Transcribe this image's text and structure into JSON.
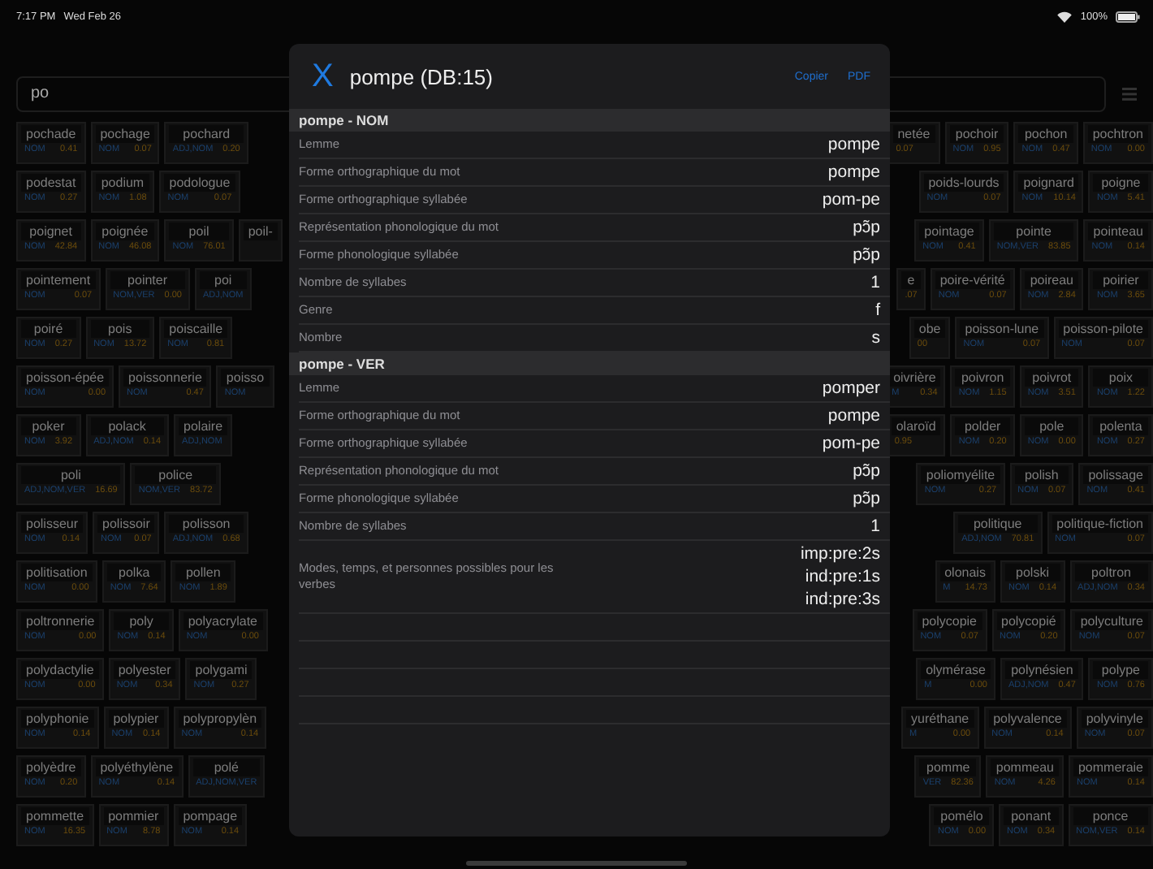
{
  "status_bar": {
    "time": "7:17 PM",
    "date": "Wed Feb 26",
    "battery": "100%"
  },
  "search": {
    "value": "po"
  },
  "tile_rows": [
    {
      "left": [
        {
          "word": "pochade",
          "category": "NOM",
          "frequency": "0.41"
        },
        {
          "word": "pochage",
          "category": "NOM",
          "frequency": "0.07"
        },
        {
          "word": "pochard",
          "category": "ADJ,NOM",
          "frequency": "0.20"
        }
      ],
      "right": [
        {
          "word": "netée",
          "frequency": "0.07"
        },
        {
          "word": "pochoir",
          "category": "NOM",
          "frequency": "0.95"
        },
        {
          "word": "pochon",
          "category": "NOM",
          "frequency": "0.47"
        },
        {
          "word": "pochtron",
          "category": "NOM",
          "frequency": "0.00"
        }
      ]
    },
    {
      "left": [
        {
          "word": "podestat",
          "category": "NOM",
          "frequency": "0.27"
        },
        {
          "word": "podium",
          "category": "NOM",
          "frequency": "1.08"
        },
        {
          "word": "podologue",
          "category": "NOM",
          "frequency": "0.07"
        }
      ],
      "right": [
        {
          "word": "poids-lourds",
          "category": "NOM",
          "frequency": "0.07"
        },
        {
          "word": "poignard",
          "category": "NOM",
          "frequency": "10.14"
        },
        {
          "word": "poigne",
          "category": "NOM",
          "frequency": "5.41"
        }
      ]
    },
    {
      "left": [
        {
          "word": "poignet",
          "category": "NOM",
          "frequency": "42.84"
        },
        {
          "word": "poignée",
          "category": "NOM",
          "frequency": "46.08"
        },
        {
          "word": "poil",
          "category": "NOM",
          "frequency": "76.01"
        },
        {
          "word": "poil-"
        }
      ],
      "right": [
        {
          "word": "pointage",
          "category": "NOM",
          "frequency": "0.41"
        },
        {
          "word": "pointe",
          "category": "NOM,VER",
          "frequency": "83.85"
        },
        {
          "word": "pointeau",
          "category": "NOM",
          "frequency": "0.14"
        }
      ]
    },
    {
      "left": [
        {
          "word": "pointement",
          "category": "NOM",
          "frequency": "0.07"
        },
        {
          "word": "pointer",
          "category": "NOM,VER",
          "frequency": "0.00"
        },
        {
          "word": "poi",
          "category": "ADJ,NOM"
        }
      ],
      "right": [
        {
          "word": "e",
          "frequency": ".07"
        },
        {
          "word": "poire-vérité",
          "category": "NOM",
          "frequency": "0.07"
        },
        {
          "word": "poireau",
          "category": "NOM",
          "frequency": "2.84"
        },
        {
          "word": "poirier",
          "category": "NOM",
          "frequency": "3.65"
        }
      ]
    },
    {
      "left": [
        {
          "word": "poiré",
          "category": "NOM",
          "frequency": "0.27"
        },
        {
          "word": "pois",
          "category": "NOM",
          "frequency": "13.72"
        },
        {
          "word": "poiscaille",
          "category": "NOM",
          "frequency": "0.81"
        }
      ],
      "right": [
        {
          "word": "obe",
          "frequency": "00"
        },
        {
          "word": "poisson-lune",
          "category": "NOM",
          "frequency": "0.07"
        },
        {
          "word": "poisson-pilote",
          "category": "NOM",
          "frequency": "0.07"
        }
      ]
    },
    {
      "left": [
        {
          "word": "poisson-épée",
          "category": "NOM",
          "frequency": "0.00"
        },
        {
          "word": "poissonnerie",
          "category": "NOM",
          "frequency": "0.47"
        },
        {
          "word": "poisso",
          "category": "NOM"
        }
      ],
      "right": [
        {
          "word": "oivrière",
          "category": "M",
          "frequency": "0.34"
        },
        {
          "word": "poivron",
          "category": "NOM",
          "frequency": "1.15"
        },
        {
          "word": "poivrot",
          "category": "NOM",
          "frequency": "3.51"
        },
        {
          "word": "poix",
          "category": "NOM",
          "frequency": "1.22"
        }
      ]
    },
    {
      "left": [
        {
          "word": "poker",
          "category": "NOM",
          "frequency": "3.92"
        },
        {
          "word": "polack",
          "category": "ADJ,NOM",
          "frequency": "0.14"
        },
        {
          "word": "polaire",
          "category": "ADJ,NOM"
        }
      ],
      "right": [
        {
          "word": "olaroïd",
          "frequency": "0.95"
        },
        {
          "word": "polder",
          "category": "NOM",
          "frequency": "0.20"
        },
        {
          "word": "pole",
          "category": "NOM",
          "frequency": "0.00"
        },
        {
          "word": "polenta",
          "category": "NOM",
          "frequency": "0.27"
        }
      ]
    },
    {
      "left": [
        {
          "word": "poli",
          "category": "ADJ,NOM,VER",
          "frequency": "16.69"
        },
        {
          "word": "police",
          "category": "NOM,VER",
          "frequency": "83.72"
        }
      ],
      "right": [
        {
          "word": "poliomyélite",
          "category": "NOM",
          "frequency": "0.27"
        },
        {
          "word": "polish",
          "category": "NOM",
          "frequency": "0.07"
        },
        {
          "word": "polissage",
          "category": "NOM",
          "frequency": "0.41"
        }
      ]
    },
    {
      "left": [
        {
          "word": "polisseur",
          "category": "NOM",
          "frequency": "0.14"
        },
        {
          "word": "polissoir",
          "category": "NOM",
          "frequency": "0.07"
        },
        {
          "word": "polisson",
          "category": "ADJ,NOM",
          "frequency": "0.68"
        }
      ],
      "right": [
        {
          "word": "politique",
          "category": "ADJ,NOM",
          "frequency": "70.81"
        },
        {
          "word": "politique-fiction",
          "category": "NOM",
          "frequency": "0.07"
        }
      ]
    },
    {
      "left": [
        {
          "word": "politisation",
          "category": "NOM",
          "frequency": "0.00"
        },
        {
          "word": "polka",
          "category": "NOM",
          "frequency": "7.64"
        },
        {
          "word": "pollen",
          "category": "NOM",
          "frequency": "1.89"
        }
      ],
      "right": [
        {
          "word": "olonais",
          "category": "M",
          "frequency": "14.73"
        },
        {
          "word": "polski",
          "category": "NOM",
          "frequency": "0.14"
        },
        {
          "word": "poltron",
          "category": "ADJ,NOM",
          "frequency": "0.34"
        }
      ]
    },
    {
      "left": [
        {
          "word": "poltronnerie",
          "category": "NOM",
          "frequency": "0.00"
        },
        {
          "word": "poly",
          "category": "NOM",
          "frequency": "0.14"
        },
        {
          "word": "polyacrylate",
          "category": "NOM",
          "frequency": "0.00"
        }
      ],
      "right": [
        {
          "word": "polycopie",
          "category": "NOM",
          "frequency": "0.07"
        },
        {
          "word": "polycopié",
          "category": "NOM",
          "frequency": "0.20"
        },
        {
          "word": "polyculture",
          "category": "NOM",
          "frequency": "0.07"
        }
      ]
    },
    {
      "left": [
        {
          "word": "polydactylie",
          "category": "NOM",
          "frequency": "0.00"
        },
        {
          "word": "polyester",
          "category": "NOM",
          "frequency": "0.34"
        },
        {
          "word": "polygami",
          "category": "NOM",
          "frequency": "0.27"
        }
      ],
      "right": [
        {
          "word": "olymérase",
          "category": "M",
          "frequency": "0.00"
        },
        {
          "word": "polynésien",
          "category": "ADJ,NOM",
          "frequency": "0.47"
        },
        {
          "word": "polype",
          "category": "NOM",
          "frequency": "0.76"
        }
      ]
    },
    {
      "left": [
        {
          "word": "polyphonie",
          "category": "NOM",
          "frequency": "0.14"
        },
        {
          "word": "polypier",
          "category": "NOM",
          "frequency": "0.14"
        },
        {
          "word": "polypropylèn",
          "category": "NOM",
          "frequency": "0.14"
        }
      ],
      "right": [
        {
          "word": "yuréthane",
          "category": "M",
          "frequency": "0.00"
        },
        {
          "word": "polyvalence",
          "category": "NOM",
          "frequency": "0.14"
        },
        {
          "word": "polyvinyle",
          "category": "NOM",
          "frequency": "0.07"
        }
      ]
    },
    {
      "left": [
        {
          "word": "polyèdre",
          "category": "NOM",
          "frequency": "0.20"
        },
        {
          "word": "polyéthylène",
          "category": "NOM",
          "frequency": "0.14"
        },
        {
          "word": "polé",
          "category": "ADJ,NOM,VER"
        }
      ],
      "right": [
        {
          "word": "pomme",
          "category": "VER",
          "frequency": "82.36"
        },
        {
          "word": "pommeau",
          "category": "NOM",
          "frequency": "4.26"
        },
        {
          "word": "pommeraie",
          "category": "NOM",
          "frequency": "0.14"
        }
      ]
    },
    {
      "left": [
        {
          "word": "pommette",
          "category": "NOM",
          "frequency": "16.35"
        },
        {
          "word": "pommier",
          "category": "NOM",
          "frequency": "8.78"
        },
        {
          "word": "pompage",
          "category": "NOM",
          "frequency": "0.14"
        }
      ],
      "right": [
        {
          "word": "pomélo",
          "category": "NOM",
          "frequency": "0.00"
        },
        {
          "word": "ponant",
          "category": "NOM",
          "frequency": "0.34"
        },
        {
          "word": "ponce",
          "category": "NOM,VER",
          "frequency": "0.14"
        }
      ]
    }
  ],
  "modal": {
    "close": "X",
    "title": "pompe (DB:15)",
    "actions": [
      "Copier",
      "PDF"
    ],
    "sections": [
      {
        "header": "pompe - NOM",
        "rows": [
          {
            "label": "Lemme",
            "values": [
              "pompe"
            ]
          },
          {
            "label": "Forme orthographique du mot",
            "values": [
              "pompe"
            ]
          },
          {
            "label": "Forme orthographique syllabée",
            "values": [
              "pom-pe"
            ]
          },
          {
            "label": "Représentation phonologique du mot",
            "values": [
              "pɔ̃p"
            ]
          },
          {
            "label": "Forme phonologique syllabée",
            "values": [
              "pɔ̃p"
            ]
          },
          {
            "label": "Nombre de syllabes",
            "values": [
              "1"
            ]
          },
          {
            "label": "Genre",
            "values": [
              "f"
            ]
          },
          {
            "label": "Nombre",
            "values": [
              "s"
            ]
          }
        ]
      },
      {
        "header": "pompe - VER",
        "rows": [
          {
            "label": "Lemme",
            "values": [
              "pomper"
            ]
          },
          {
            "label": "Forme orthographique du mot",
            "values": [
              "pompe"
            ]
          },
          {
            "label": "Forme orthographique syllabée",
            "values": [
              "pom-pe"
            ]
          },
          {
            "label": "Représentation phonologique du mot",
            "values": [
              "pɔ̃p"
            ]
          },
          {
            "label": "Forme phonologique syllabée",
            "values": [
              "pɔ̃p"
            ]
          },
          {
            "label": "Nombre de syllabes",
            "values": [
              "1"
            ]
          },
          {
            "label": "Modes, temps, et personnes possibles pour les verbes",
            "values": [
              "imp:pre:2s",
              "ind:pre:1s",
              "ind:pre:3s"
            ]
          }
        ]
      }
    ]
  }
}
